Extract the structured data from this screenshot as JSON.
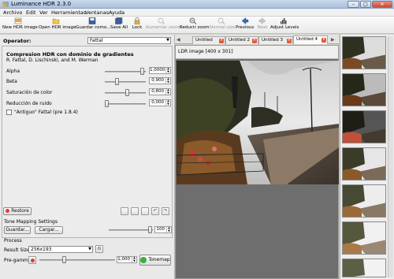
{
  "window": {
    "title": "Luminance HDR 2.3.0",
    "controls": [
      "–",
      "□",
      "✕"
    ]
  },
  "menu": [
    "Archivo",
    "Edit",
    "Ver",
    "Herramientas",
    "Ventanas",
    "Ayuda"
  ],
  "toolbar": [
    {
      "label": "New HDR image",
      "icon": "new-hdr-icon",
      "enabled": true
    },
    {
      "label": "Open HDR image",
      "icon": "open-hdr-icon",
      "enabled": true
    },
    {
      "label": "Guardar como...",
      "icon": "save-as-icon",
      "enabled": true
    },
    {
      "label": "Save All",
      "icon": "save-all-icon",
      "enabled": true
    },
    {
      "label": "Lock",
      "icon": "lock-icon",
      "enabled": true
    },
    {
      "label": "Aumentar zoom",
      "icon": "zoom-in-icon",
      "enabled": false
    },
    {
      "label": "Reducir zoom",
      "icon": "zoom-out-icon",
      "enabled": true
    },
    {
      "label": "Normal size",
      "icon": "normal-size-icon",
      "enabled": false
    },
    {
      "label": "Previous",
      "icon": "previous-arrow-icon",
      "enabled": true
    },
    {
      "label": "Next",
      "icon": "next-arrow-icon",
      "enabled": false
    },
    {
      "label": "Adjust Levels",
      "icon": "adjust-levels-icon",
      "enabled": true
    }
  ],
  "operator": {
    "label": "Operator:",
    "value": "Fattal",
    "title": "Compresion HDR con dominio de gradientes",
    "authors": "R. Fattal, D. Lischinski, and M. Werman",
    "params": [
      {
        "label": "Alpha",
        "value": "1,0000",
        "level": 0.95
      },
      {
        "label": "Beta",
        "value": "0,900",
        "level": 0.28
      },
      {
        "label": "Saturación de color",
        "value": "0,800",
        "level": 0.52
      },
      {
        "label": "Reducción de ruido",
        "value": "0,000",
        "level": 0.0
      }
    ],
    "checkbox_label": "\"Antiguo\" Fattal (pre 1.8.4)",
    "checkbox_checked": false
  },
  "restore_label": "Restore",
  "tm_settings": {
    "header": "Tone Mapping Settings",
    "save_label": "Guardar...",
    "load_label": "Cargar...",
    "quality_value": "100",
    "quality_level": 0.96
  },
  "process": {
    "header": "Process",
    "result_size_label": "Result Size:",
    "result_size_value": "256x193",
    "pregamma_label": "Pre-gamma:",
    "pregamma_value": "1,000",
    "pregamma_level": 0.32,
    "tonemap_label": "Tonemap"
  },
  "tabs": [
    {
      "label": "Untitled",
      "active": false
    },
    {
      "label": "Untitled 2",
      "active": false
    },
    {
      "label": "Untitled 3",
      "active": false
    },
    {
      "label": "Untitled 4",
      "active": true
    }
  ],
  "viewer": {
    "caption": "LDR image [400 x 301]"
  },
  "colors": {
    "accent_green": "#3cae3c",
    "title_bar": "#b8cbe4",
    "tab_close": "#e25b3c"
  }
}
